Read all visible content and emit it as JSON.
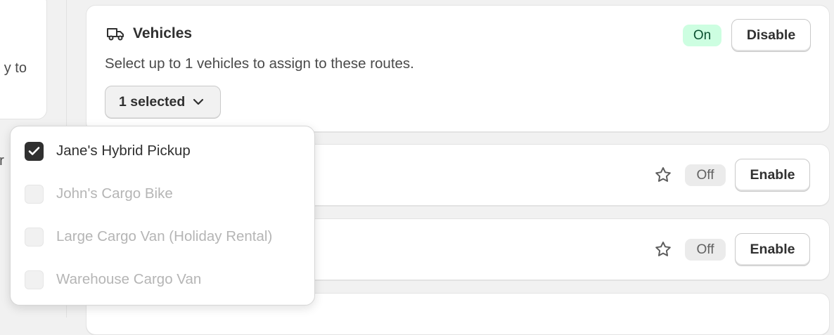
{
  "background_fragments": {
    "left_card_text": "y to",
    "left_text_2": "er"
  },
  "vehicles_card": {
    "title": "Vehicles",
    "icon": "truck-icon",
    "description": "Select up to 1 vehicles to assign to these routes.",
    "select_label": "1 selected",
    "status_badge": "On",
    "disable_button": "Disable"
  },
  "other_cards": [
    {
      "status_badge": "Off",
      "enable_button": "Enable",
      "icon": "star-icon"
    },
    {
      "status_badge": "Off",
      "enable_button": "Enable",
      "icon": "star-icon"
    }
  ],
  "dropdown": {
    "options": [
      {
        "label": "Jane's Hybrid Pickup",
        "checked": true,
        "disabled": false
      },
      {
        "label": "John's Cargo Bike",
        "checked": false,
        "disabled": true
      },
      {
        "label": "Large Cargo Van (Holiday Rental)",
        "checked": false,
        "disabled": true
      },
      {
        "label": "Warehouse Cargo Van",
        "checked": false,
        "disabled": true
      }
    ]
  },
  "colors": {
    "page_bg": "#f1f1f1",
    "on_badge_bg": "#cdfee1",
    "off_badge_bg": "#ebebeb",
    "checked_box": "#303030"
  }
}
